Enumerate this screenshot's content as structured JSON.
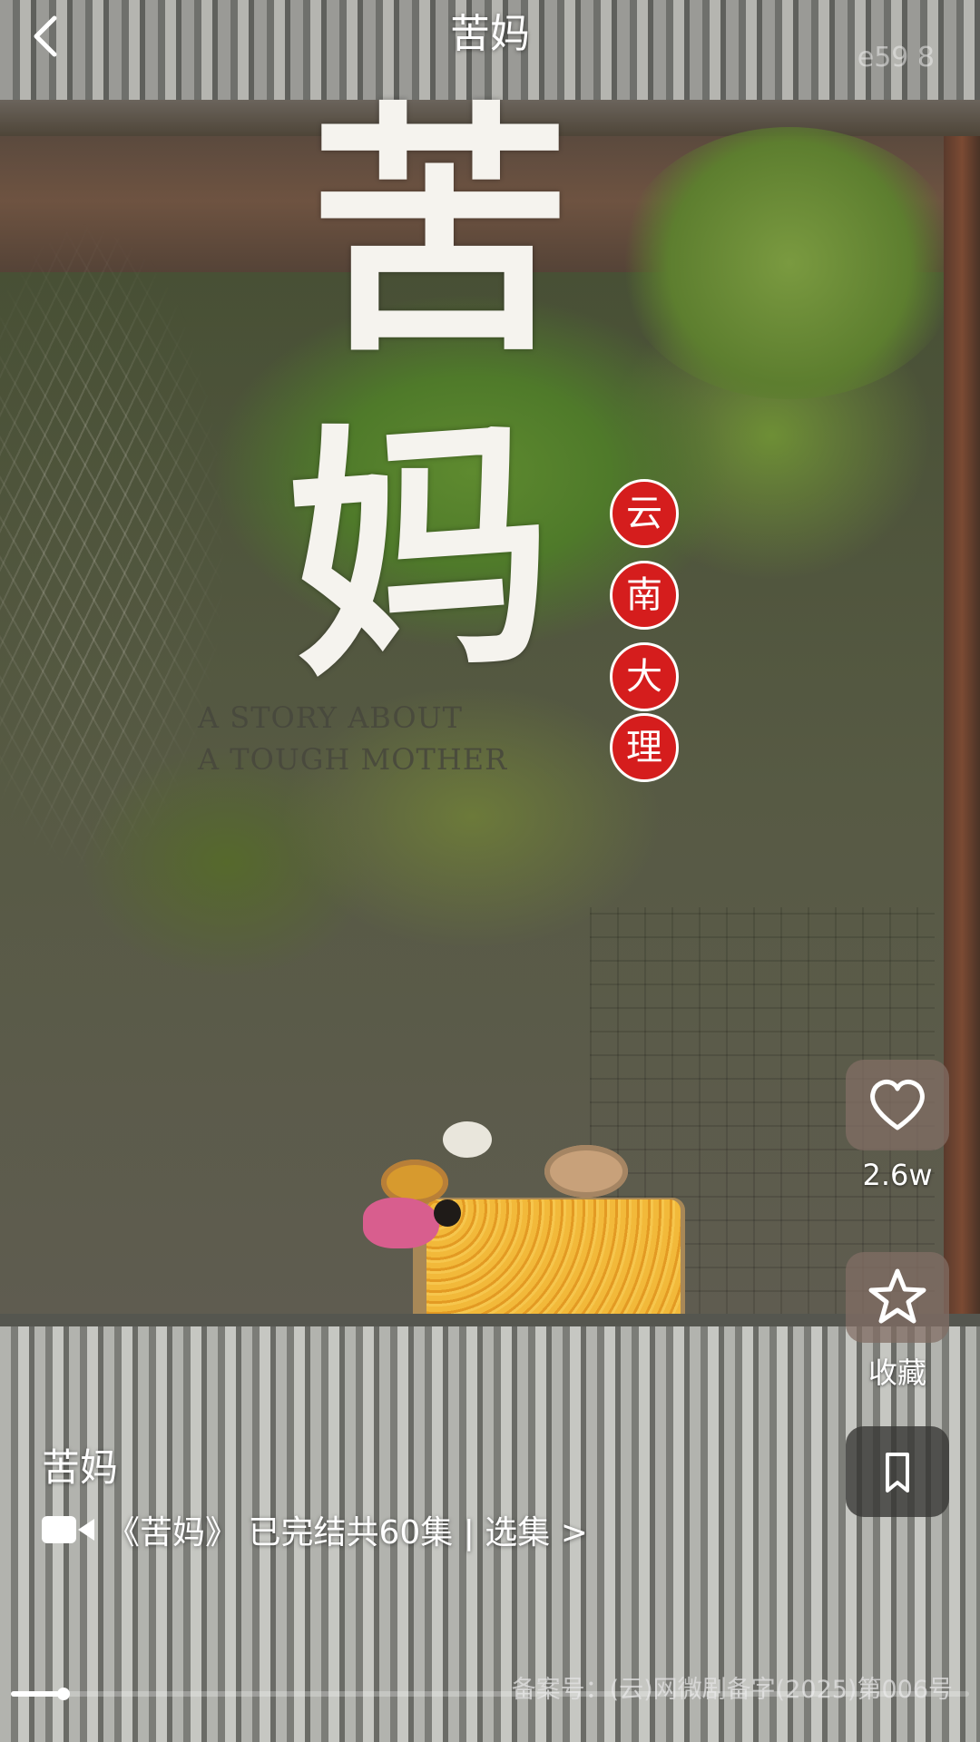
{
  "header": {
    "title": "苦妈",
    "watermark": "e59 8"
  },
  "poster": {
    "title_char_1": "苦",
    "title_char_2": "妈",
    "seal_chars": [
      "云",
      "南",
      "大",
      "理"
    ],
    "english_line_1": "A STORY ABOUT",
    "english_line_2": "A TOUGH MOTHER"
  },
  "actions": {
    "like_count": "2.6w",
    "favorite_label": "收藏"
  },
  "info": {
    "drama_title": "苦妈",
    "episode_text": "《苦妈》 已完结共60集 | 选集 >",
    "license": "备案号：(云)网微剧备字(2025)第006号"
  },
  "playback": {
    "progress_fraction": 0.055
  },
  "icons": {
    "back": "chevron-left-icon",
    "like": "heart-icon",
    "favorite": "star-icon",
    "bookmark": "bookmark-icon",
    "episodes": "video-camera-icon"
  }
}
